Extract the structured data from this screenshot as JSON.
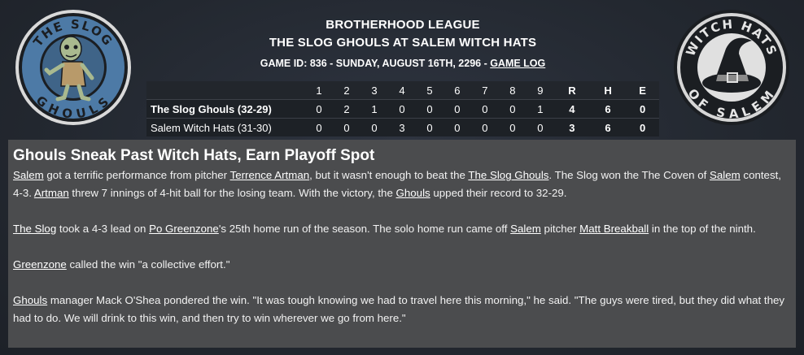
{
  "header": {
    "league": "BROTHERHOOD LEAGUE",
    "matchup": "THE SLOG GHOULS AT SALEM WITCH HATS",
    "game_info": "GAME ID: 836 - SUNDAY, AUGUST 16TH, 2296 - ",
    "game_log_link": "GAME LOG"
  },
  "logos": {
    "away": {
      "top_text": "THE SLOG",
      "bottom_text": "GHOULS",
      "icon": "ghoul-mascot-icon"
    },
    "home": {
      "top_text": "WITCH HATS",
      "bottom_text": "OF SALEM",
      "icon": "witch-hat-icon"
    }
  },
  "boxscore": {
    "innings": [
      "1",
      "2",
      "3",
      "4",
      "5",
      "6",
      "7",
      "8",
      "9"
    ],
    "rhe": [
      "R",
      "H",
      "E"
    ],
    "teams": [
      {
        "name": "The Slog Ghouls (32-29)",
        "innings": [
          "0",
          "2",
          "1",
          "0",
          "0",
          "0",
          "0",
          "0",
          "1"
        ],
        "r": "4",
        "h": "6",
        "e": "0"
      },
      {
        "name": "Salem Witch Hats (31-30)",
        "innings": [
          "0",
          "0",
          "0",
          "3",
          "0",
          "0",
          "0",
          "0",
          "0"
        ],
        "r": "3",
        "h": "6",
        "e": "0"
      }
    ]
  },
  "article": {
    "title": "Ghouls Sneak Past Witch Hats, Earn Playoff Spot",
    "p1": {
      "salem1": "Salem",
      "t1": " got a terrific performance from pitcher ",
      "artman1": "Terrence Artman",
      "t2": ", but it wasn't enough to beat the ",
      "slog_ghouls": "The Slog Ghouls",
      "t3": ". The Slog won the The Coven of ",
      "salem2": "Salem",
      "t4": " contest, 4-3. ",
      "artman2": "Artman",
      "t5": " threw 7 innings of 4-hit ball for the losing team. With the victory, the ",
      "ghouls": "Ghouls",
      "t6": " upped their record to 32-29."
    },
    "p2": {
      "the_slog": "The Slog",
      "t1": " took a 4-3 lead on ",
      "greenzone": "Po Greenzone",
      "t2": "'s 25th home run of the season. The solo home run came off ",
      "salem": "Salem",
      "t3": " pitcher ",
      "breakball": "Matt Breakball",
      "t4": " in the top of the ninth."
    },
    "p3": {
      "greenzone": "Greenzone",
      "t1": " called the win \"a collective effort.\""
    },
    "p4": {
      "ghouls": "Ghouls",
      "t1": " manager Mack O'Shea pondered the win. \"It was tough knowing we had to travel here this morning,\" he said. \"The guys were tired, but they did what they had to do. We will drink to this win, and then try to win wherever we go from here.\""
    }
  },
  "colors": {
    "background": "#262b33",
    "article_bg": "#4b4c4e",
    "logo_blue": "#4d7aa6",
    "logo_dark": "#1c1f24"
  }
}
